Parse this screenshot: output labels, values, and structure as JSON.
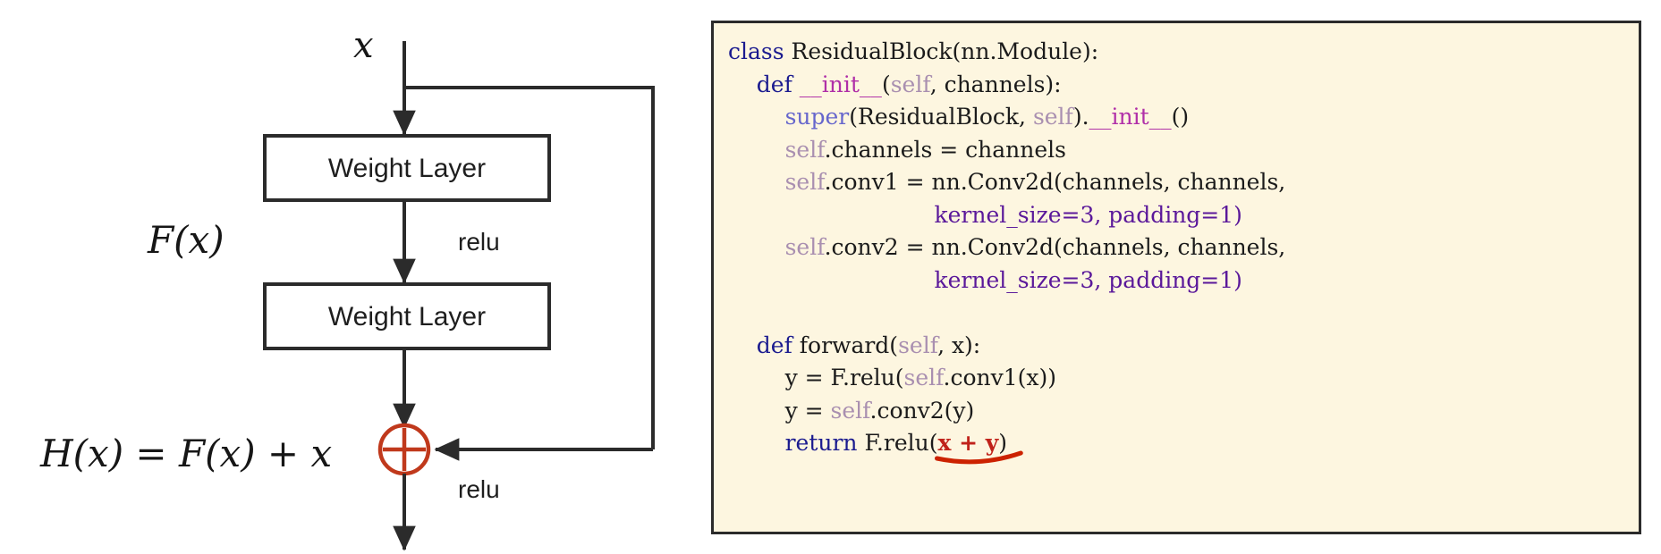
{
  "diagram": {
    "title_absent": true,
    "input_label": "x",
    "blocks": [
      {
        "label": "Weight Layer"
      },
      {
        "label": "Weight Layer"
      }
    ],
    "edge_labels": {
      "relu_mid": "relu",
      "relu_out": "relu"
    },
    "function_label": "F(x)",
    "output_equation": "H(x) = F(x) + x",
    "add_node_symbol": "+",
    "colors": {
      "stroke": "#2b2b2b",
      "add_node": "#c0391c",
      "text": "#1a1a1a"
    }
  },
  "code_panel": {
    "background": "#fdf6e0",
    "border": "#2b2b2b",
    "lines": [
      {
        "id": "line-class",
        "tokens": [
          {
            "t": "class ",
            "c": "kw"
          },
          {
            "t": "ResidualBlock(nn.Module):",
            "c": "plain"
          }
        ]
      },
      {
        "id": "line-init-def",
        "tokens": [
          {
            "t": "    ",
            "c": "plain"
          },
          {
            "t": "def ",
            "c": "kw"
          },
          {
            "t": "__init__",
            "c": "dunder"
          },
          {
            "t": "(",
            "c": "plain"
          },
          {
            "t": "self",
            "c": "selfkw"
          },
          {
            "t": ", channels):",
            "c": "plain"
          }
        ]
      },
      {
        "id": "line-super",
        "tokens": [
          {
            "t": "        ",
            "c": "plain"
          },
          {
            "t": "super",
            "c": "superkw"
          },
          {
            "t": "(ResidualBlock, ",
            "c": "plain"
          },
          {
            "t": "self",
            "c": "selfkw"
          },
          {
            "t": ").",
            "c": "plain"
          },
          {
            "t": "__init__",
            "c": "dunder"
          },
          {
            "t": "()",
            "c": "plain"
          }
        ]
      },
      {
        "id": "line-channels",
        "tokens": [
          {
            "t": "        ",
            "c": "plain"
          },
          {
            "t": "self",
            "c": "selfkw"
          },
          {
            "t": ".channels = channels",
            "c": "plain"
          }
        ]
      },
      {
        "id": "line-conv1",
        "tokens": [
          {
            "t": "        ",
            "c": "plain"
          },
          {
            "t": "self",
            "c": "selfkw"
          },
          {
            "t": ".conv1 = nn.Conv2d(channels, channels,",
            "c": "plain"
          }
        ]
      },
      {
        "id": "line-conv1-args",
        "tokens": [
          {
            "t": "                             ",
            "c": "plain"
          },
          {
            "t": "kernel_size=3, padding=1)",
            "c": "kwarg"
          }
        ]
      },
      {
        "id": "line-conv2",
        "tokens": [
          {
            "t": "        ",
            "c": "plain"
          },
          {
            "t": "self",
            "c": "selfkw"
          },
          {
            "t": ".conv2 = nn.Conv2d(channels, channels,",
            "c": "plain"
          }
        ]
      },
      {
        "id": "line-conv2-args",
        "tokens": [
          {
            "t": "                             ",
            "c": "plain"
          },
          {
            "t": "kernel_size=3, padding=1)",
            "c": "kwarg"
          }
        ]
      },
      {
        "id": "line-blank",
        "tokens": [
          {
            "t": " ",
            "c": "plain"
          }
        ]
      },
      {
        "id": "line-forward-def",
        "tokens": [
          {
            "t": "    ",
            "c": "plain"
          },
          {
            "t": "def ",
            "c": "kw"
          },
          {
            "t": "forward(",
            "c": "plain"
          },
          {
            "t": "self",
            "c": "selfkw"
          },
          {
            "t": ", x):",
            "c": "plain"
          }
        ]
      },
      {
        "id": "line-y1",
        "tokens": [
          {
            "t": "        y = F.relu(",
            "c": "plain"
          },
          {
            "t": "self",
            "c": "selfkw"
          },
          {
            "t": ".conv1(x))",
            "c": "plain"
          }
        ]
      },
      {
        "id": "line-y2",
        "tokens": [
          {
            "t": "        y = ",
            "c": "plain"
          },
          {
            "t": "self",
            "c": "selfkw"
          },
          {
            "t": ".conv2(y)",
            "c": "plain"
          }
        ]
      },
      {
        "id": "line-return",
        "tokens": [
          {
            "t": "        ",
            "c": "plain"
          },
          {
            "t": "return ",
            "c": "kw"
          },
          {
            "t": "F.relu(",
            "c": "plain"
          },
          {
            "t": "x + y",
            "c": "hl"
          },
          {
            "t": ")",
            "c": "plain"
          }
        ]
      }
    ],
    "annotation": {
      "underline_color": "#cc2200",
      "underlined_text": "x + y"
    }
  }
}
